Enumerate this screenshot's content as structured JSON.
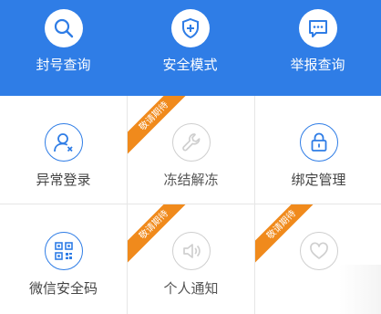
{
  "header": {
    "items": [
      {
        "label": "封号查询",
        "icon": "search-icon"
      },
      {
        "label": "安全模式",
        "icon": "shield-plus-icon"
      },
      {
        "label": "举报查询",
        "icon": "report-chat-icon"
      }
    ]
  },
  "grid": {
    "ribbon_text": "敬请期待",
    "items": [
      {
        "label": "异常登录",
        "icon": "user-alert-icon",
        "disabled": false
      },
      {
        "label": "冻结解冻",
        "icon": "wrench-icon",
        "disabled": true
      },
      {
        "label": "绑定管理",
        "icon": "lock-icon",
        "disabled": false
      },
      {
        "label": "微信安全码",
        "icon": "qr-code-icon",
        "disabled": false
      },
      {
        "label": "个人通知",
        "icon": "speaker-icon",
        "disabled": true
      },
      {
        "label": "",
        "icon": "heart-icon",
        "disabled": true
      }
    ]
  },
  "colors": {
    "brand_blue": "#2f7de6",
    "ribbon_orange": "#f08a1c",
    "disabled_gray": "#cfcfcf"
  }
}
